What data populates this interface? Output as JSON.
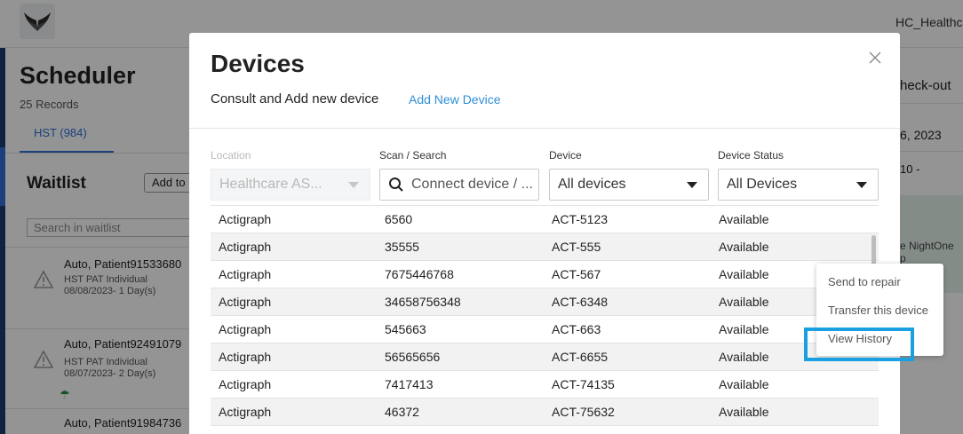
{
  "app": {
    "user_name": "HC_Healthc",
    "title": "Scheduler",
    "records": "25 Records",
    "tab_label": "HST (984)"
  },
  "waitlist": {
    "title": "Waitlist",
    "add_label": "Add to",
    "search_placeholder": "Search in waitlist",
    "cards": [
      {
        "name": "Auto, Patient91533680",
        "type": "HST PAT Individual",
        "date": "08/08/2023- 1 Day(s)"
      },
      {
        "name": "Auto, Patient92491079",
        "type": "HST PAT Individual",
        "date": "08/07/2023- 2 Day(s)"
      },
      {
        "name": "Auto, Patient91984736",
        "type": "",
        "date": ""
      }
    ]
  },
  "right_col": {
    "checkout": "heck-out",
    "date": "6, 2023",
    "time": "10 -",
    "nightone_1": "e NightOne",
    "nightone_2": "p"
  },
  "modal": {
    "title": "Devices",
    "subtitle": "Consult and Add new device",
    "add_link": "Add New Device",
    "filters": {
      "location_label": "Location",
      "location_value": "Healthcare AS...",
      "search_label": "Scan / Search",
      "search_placeholder": "Connect device / ...",
      "device_label": "Device",
      "device_value": "All devices",
      "status_label": "Device Status",
      "status_value": "All Devices"
    },
    "rows": [
      [
        "Actigraph",
        "6560",
        "ACT-5123",
        "Available"
      ],
      [
        "Actigraph",
        "35555",
        "ACT-555",
        "Available"
      ],
      [
        "Actigraph",
        "7675446768",
        "ACT-567",
        "Available"
      ],
      [
        "Actigraph",
        "34658756348",
        "ACT-6348",
        "Available"
      ],
      [
        "Actigraph",
        "545663",
        "ACT-663",
        "Available"
      ],
      [
        "Actigraph",
        "56565656",
        "ACT-6655",
        "Available"
      ],
      [
        "Actigraph",
        "7417413",
        "ACT-74135",
        "Available"
      ],
      [
        "Actigraph",
        "46372",
        "ACT-75632",
        "Available"
      ]
    ]
  },
  "context_menu": {
    "items": [
      "Send to repair",
      "Transfer this device",
      "View History"
    ]
  },
  "icons": {
    "close": "close-icon",
    "search": "search-icon",
    "caret": "chevron-down-icon",
    "warning": "warning-icon",
    "logo": "wings-logo-icon",
    "umbrella": "umbrella-icon"
  },
  "colors": {
    "accent_link": "#2f8fd8",
    "highlight_box": "#1aa0e0",
    "tab_accent": "#2f6fd6"
  }
}
